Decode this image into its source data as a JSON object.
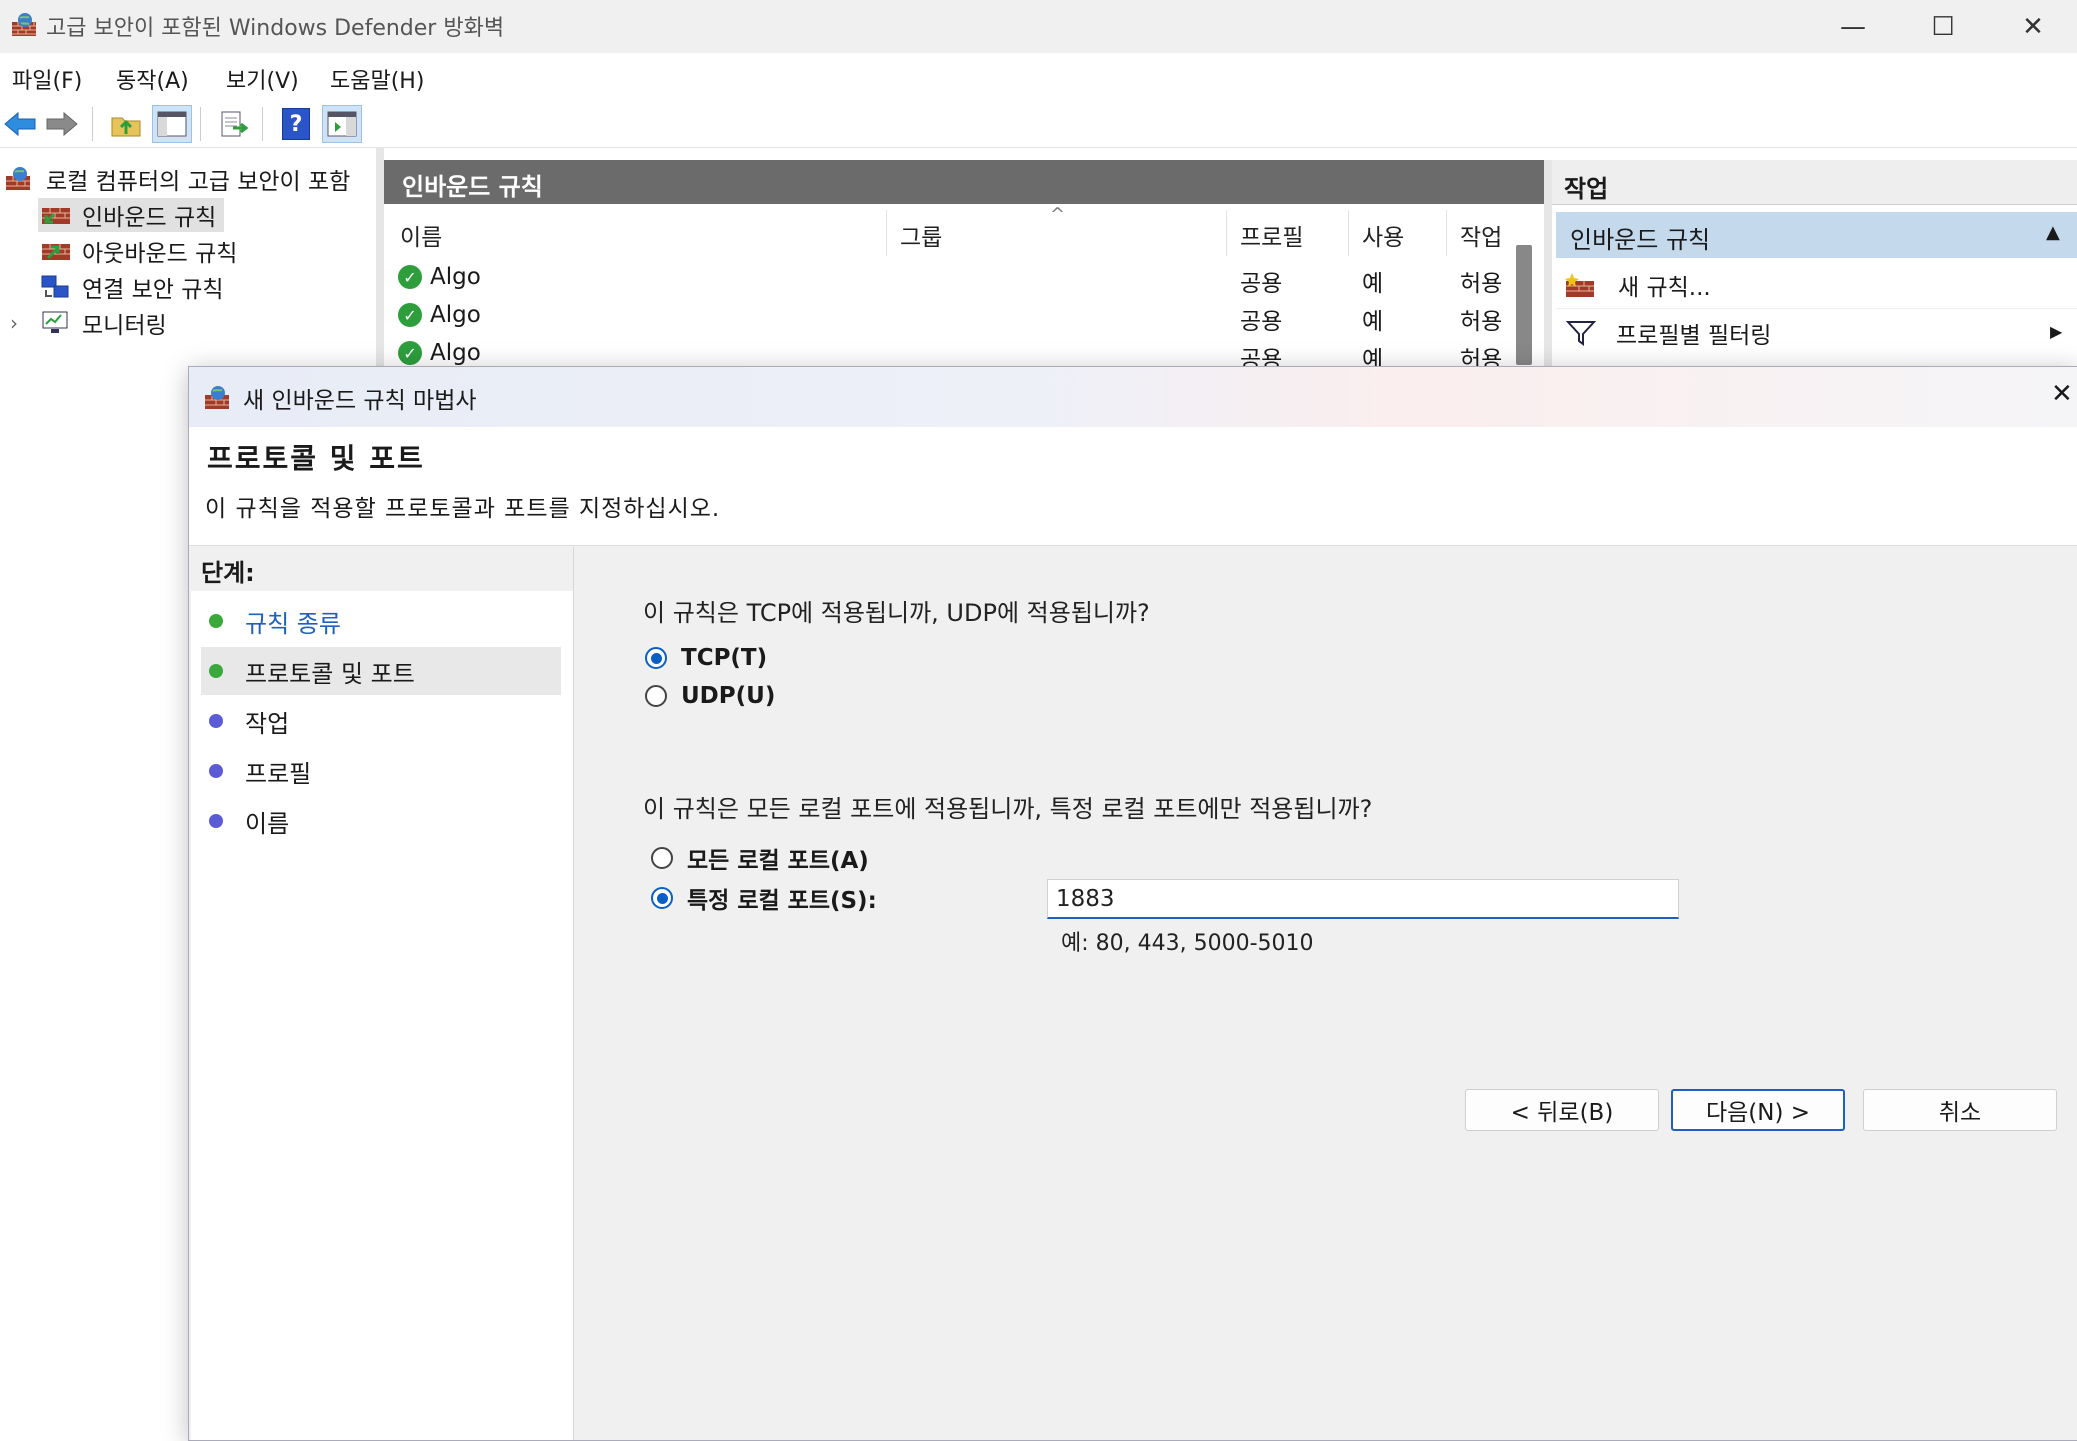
{
  "window": {
    "title": "고급 보안이 포함된 Windows Defender 방화벽",
    "controls": {
      "minimize": "—",
      "maximize": "☐",
      "close": "✕"
    }
  },
  "menu": [
    "파일(F)",
    "동작(A)",
    "보기(V)",
    "도움말(H)"
  ],
  "toolbar": {
    "icons": [
      "back-arrow-icon",
      "forward-arrow-icon",
      "up-folder-icon",
      "show-hide-tree-icon",
      "export-list-icon",
      "help-icon",
      "show-hide-action-pane-icon"
    ],
    "help_glyph": "?"
  },
  "tree": {
    "root": "로컬 컴퓨터의 고급 보안이 포함",
    "items": [
      "인바운드 규칙",
      "아웃바운드 규칙",
      "연결 보안 규칙",
      "모니터링"
    ],
    "expander": "›"
  },
  "center": {
    "header": "인바운드 규칙",
    "columns": [
      "이름",
      "그룹",
      "프로필",
      "사용",
      "작업"
    ],
    "sort_glyph": "^",
    "rows": [
      {
        "name": "Algo",
        "group": "",
        "profile": "공용",
        "enabled": "예",
        "action": "허용"
      },
      {
        "name": "Algo",
        "group": "",
        "profile": "공용",
        "enabled": "예",
        "action": "허용"
      },
      {
        "name": "Algo",
        "group": "",
        "profile": "공용",
        "enabled": "예",
        "action": "허용"
      }
    ],
    "check_glyph": "✓"
  },
  "actions": {
    "header": "작업",
    "section": "인바운드 규칙",
    "section_glyph": "▲",
    "items": [
      "새 규칙...",
      "프로필별 필터링"
    ],
    "submenu_glyph": "▶"
  },
  "wizard": {
    "title": "새 인바운드 규칙 마법사",
    "close": "✕",
    "heading": "프로토콜 및 포트",
    "subheading": "이 규칙을 적용할 프로토콜과 포트를 지정하십시오.",
    "steps_label": "단계:",
    "steps": [
      {
        "label": "규칙 종류",
        "state": "done"
      },
      {
        "label": "프로토콜 및 포트",
        "state": "current"
      },
      {
        "label": "작업",
        "state": "pending"
      },
      {
        "label": "프로필",
        "state": "pending"
      },
      {
        "label": "이름",
        "state": "pending"
      }
    ],
    "question1": "이 규칙은 TCP에 적용됩니까, UDP에 적용됩니까?",
    "protocol_options": [
      {
        "label": "TCP(T)",
        "selected": true
      },
      {
        "label": "UDP(U)",
        "selected": false
      }
    ],
    "question2": "이 규칙은 모든 로컬 포트에 적용됩니까, 특정 로컬 포트에만 적용됩니까?",
    "port_options": [
      {
        "label": "모든 로컬 포트(A)",
        "selected": false
      },
      {
        "label": "특정 로컬 포트(S):",
        "selected": true
      }
    ],
    "port_value": "1883",
    "port_example": "예: 80, 443, 5000-5010",
    "buttons": {
      "back": "< 뒤로(B)",
      "next": "다음(N) >",
      "cancel": "취소"
    }
  },
  "colors": {
    "step_done": "#3aa83a",
    "step_pending": "#5b5bd6",
    "accent": "#0a5fc4",
    "link": "#1f5fbf",
    "pane_header": "#6b6b6b",
    "action_selected": "#c5d9ed"
  }
}
